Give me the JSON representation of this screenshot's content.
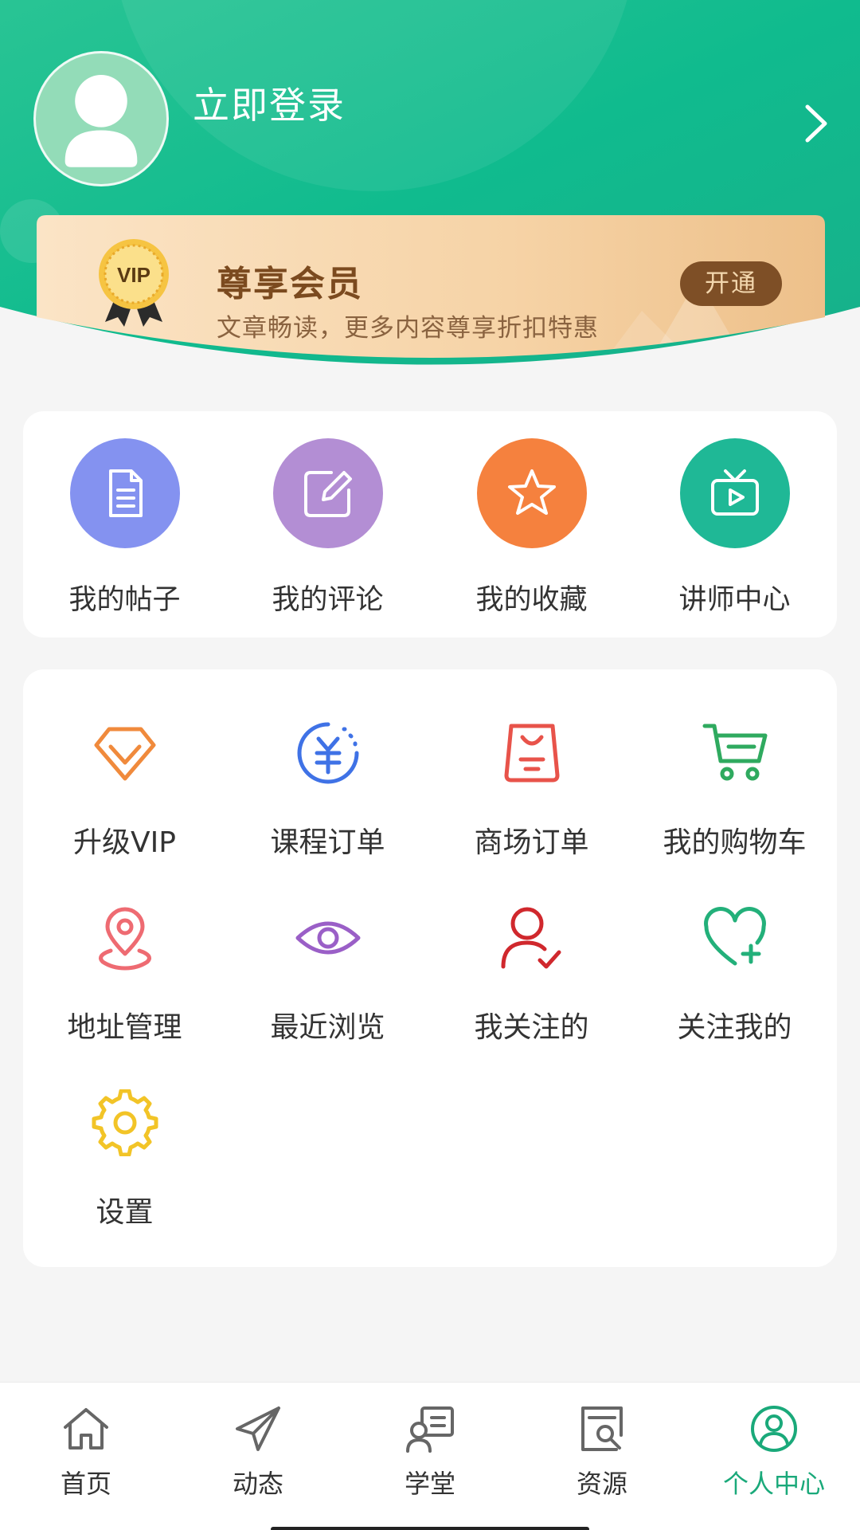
{
  "header": {
    "login_text": "立即登录"
  },
  "vip": {
    "badge_text": "VIP",
    "title": "尊享会员",
    "subtitle": "文章畅读，更多内容尊享折扣特惠",
    "open_label": "开通"
  },
  "quick_actions": [
    {
      "label": "我的帖子",
      "icon": "document-icon",
      "color": "#8492f0"
    },
    {
      "label": "我的评论",
      "icon": "edit-icon",
      "color": "#b38ed4"
    },
    {
      "label": "我的收藏",
      "icon": "star-icon",
      "color": "#f5813e"
    },
    {
      "label": "讲师中心",
      "icon": "tv-icon",
      "color": "#1fb896"
    }
  ],
  "services": [
    {
      "label": "升级VIP",
      "icon": "diamond-icon",
      "color": "#f08a3c"
    },
    {
      "label": "课程订单",
      "icon": "yuan-coin-icon",
      "color": "#3f72e6"
    },
    {
      "label": "商场订单",
      "icon": "shopping-bag-icon",
      "color": "#e8534a"
    },
    {
      "label": "我的购物车",
      "icon": "cart-icon",
      "color": "#2faa5f"
    },
    {
      "label": "地址管理",
      "icon": "location-pin-icon",
      "color": "#ee6b72"
    },
    {
      "label": "最近浏览",
      "icon": "eye-icon",
      "color": "#9a5fc7"
    },
    {
      "label": "我关注的",
      "icon": "user-check-icon",
      "color": "#d0282d"
    },
    {
      "label": "关注我的",
      "icon": "heart-plus-icon",
      "color": "#23b07a"
    },
    {
      "label": "设置",
      "icon": "gear-icon",
      "color": "#f2c427"
    }
  ],
  "tabbar": [
    {
      "label": "首页",
      "icon": "home-icon"
    },
    {
      "label": "动态",
      "icon": "paper-plane-icon"
    },
    {
      "label": "学堂",
      "icon": "classroom-icon"
    },
    {
      "label": "资源",
      "icon": "resource-search-icon"
    },
    {
      "label": "个人中心",
      "icon": "profile-icon",
      "active": true
    }
  ],
  "colors": {
    "brand_green": "#13b98a",
    "active_tab": "#1aa97a",
    "vip_brown": "#7e4f26"
  }
}
